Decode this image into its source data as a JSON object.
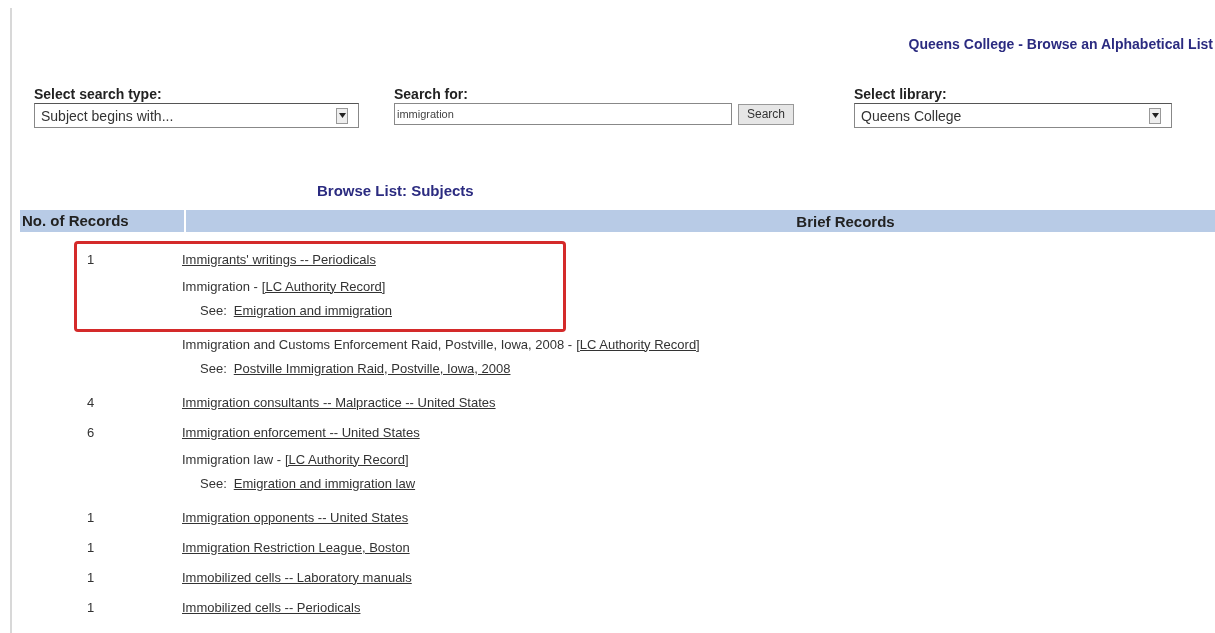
{
  "page_title": "Queens College - Browse an Alphabetical List",
  "search_form": {
    "search_type": {
      "label": "Select search type:",
      "value": "Subject begins with..."
    },
    "search_for": {
      "label": "Search for:",
      "value": "immigration"
    },
    "search_button": "Search",
    "library": {
      "label": "Select library:",
      "value": "Queens College"
    }
  },
  "browse_heading": "Browse List: Subjects",
  "table": {
    "columns": [
      "No. of Records",
      "Brief Records"
    ],
    "rows": [
      {
        "kind": "record",
        "count": "1",
        "heading": "Immigrants' writings -- Periodicals",
        "highlighted": true
      },
      {
        "kind": "authority",
        "heading": "Immigration -",
        "authority_link": "[LC Authority Record]",
        "see_label": "See:",
        "see_link": "Emigration and immigration",
        "highlighted": true
      },
      {
        "kind": "authority",
        "heading": "Immigration and Customs Enforcement Raid, Postville, Iowa, 2008 -",
        "authority_link": "[LC Authority Record]",
        "see_label": "See:",
        "see_link": "Postville Immigration Raid, Postville, Iowa, 2008",
        "highlighted": false
      },
      {
        "kind": "record",
        "count": "4",
        "heading": "Immigration consultants -- Malpractice -- United States",
        "highlighted": false
      },
      {
        "kind": "record",
        "count": "6",
        "heading": "Immigration enforcement -- United States",
        "highlighted": false
      },
      {
        "kind": "authority",
        "heading": "Immigration law -",
        "authority_link": "[LC Authority Record]",
        "see_label": "See:",
        "see_link": "Emigration and immigration law",
        "highlighted": false
      },
      {
        "kind": "record",
        "count": "1",
        "heading": "Immigration opponents -- United States",
        "highlighted": false
      },
      {
        "kind": "record",
        "count": "1",
        "heading": "Immigration Restriction League, Boston",
        "highlighted": false
      },
      {
        "kind": "record",
        "count": "1",
        "heading": "Immobilized cells -- Laboratory manuals",
        "highlighted": false
      },
      {
        "kind": "record",
        "count": "1",
        "heading": "Immobilized cells -- Periodicals",
        "highlighted": false
      }
    ]
  }
}
